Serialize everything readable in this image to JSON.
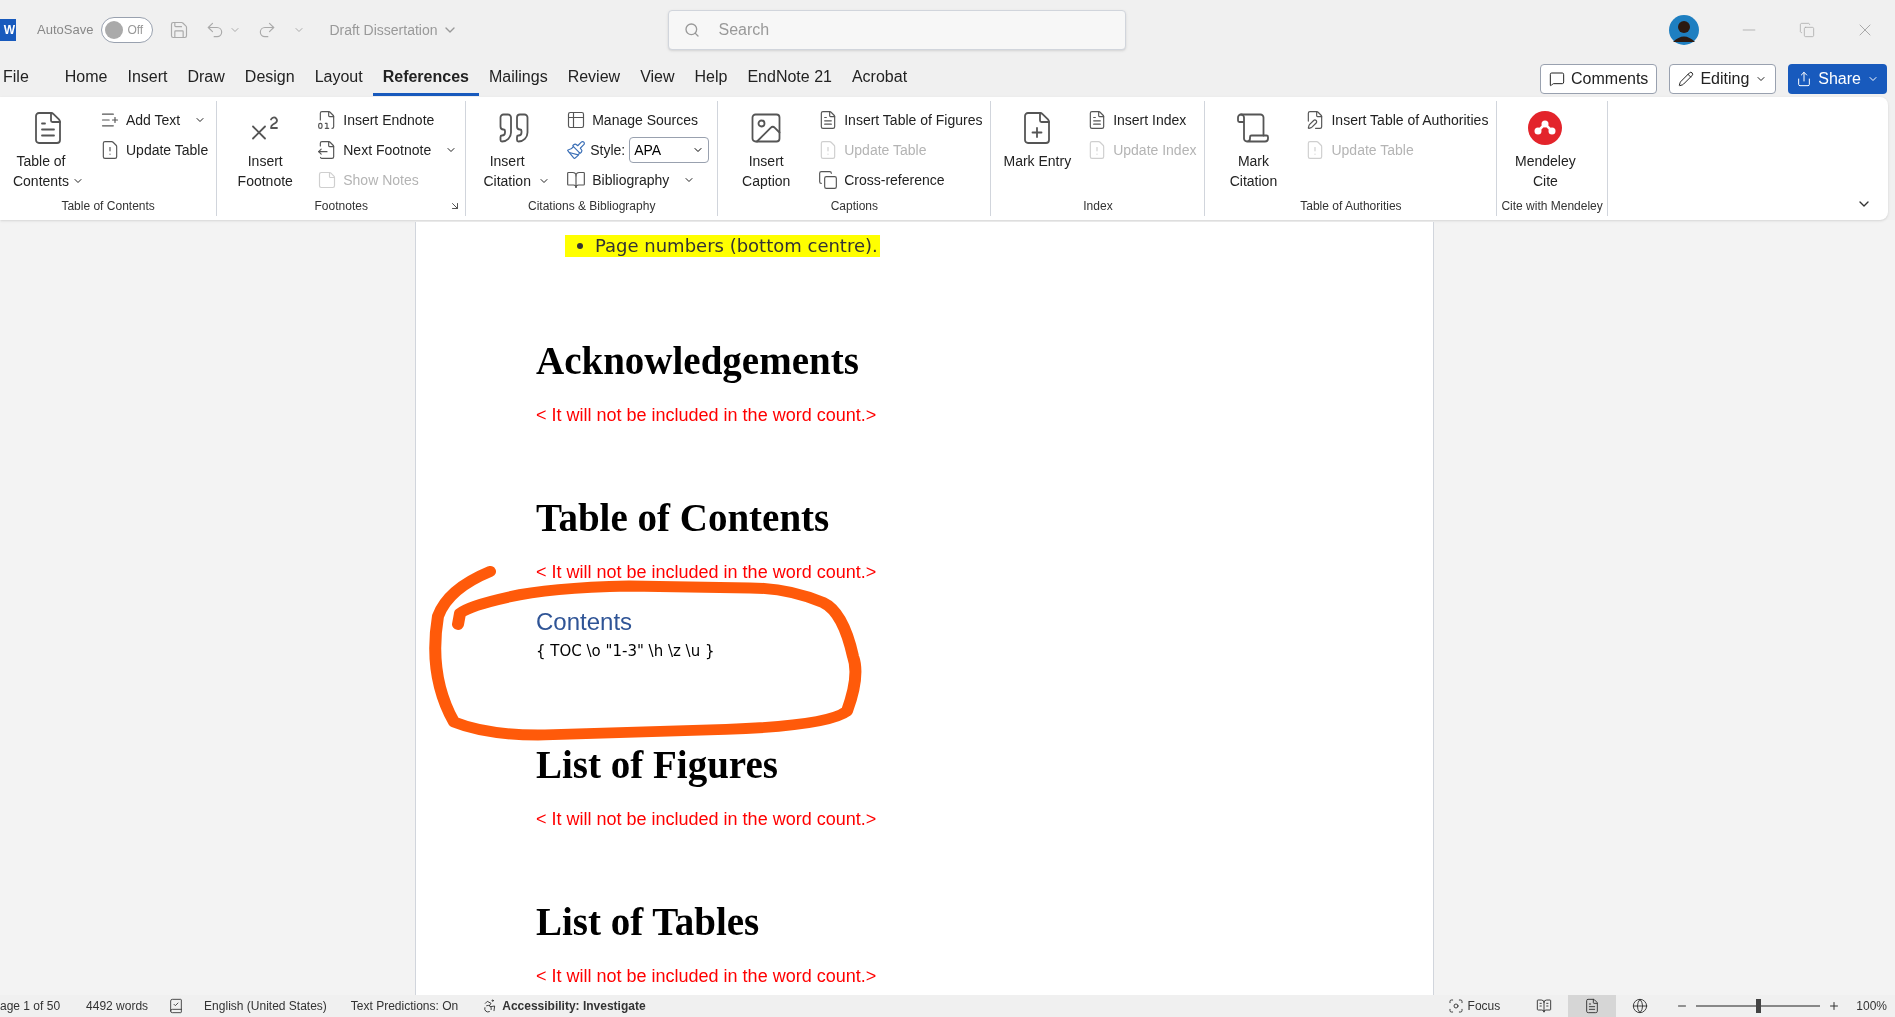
{
  "title_bar": {
    "app_letter": "W",
    "autosave_label": "AutoSave",
    "autosave": {
      "on": false,
      "label": "Off"
    },
    "document_title": "Draft Dissertation",
    "search": {
      "placeholder": "Search"
    }
  },
  "tabs": [
    {
      "label": "File",
      "selected": false
    },
    {
      "label": "Home",
      "selected": false
    },
    {
      "label": "Insert",
      "selected": false
    },
    {
      "label": "Draw",
      "selected": false
    },
    {
      "label": "Design",
      "selected": false
    },
    {
      "label": "Layout",
      "selected": false
    },
    {
      "label": "References",
      "selected": true
    },
    {
      "label": "Mailings",
      "selected": false
    },
    {
      "label": "Review",
      "selected": false
    },
    {
      "label": "View",
      "selected": false
    },
    {
      "label": "Help",
      "selected": false
    },
    {
      "label": "EndNote 21",
      "selected": false
    },
    {
      "label": "Acrobat",
      "selected": false
    }
  ],
  "header_buttons": [
    {
      "kind": "outline",
      "label": "Comments",
      "dropdown": false
    },
    {
      "kind": "outline",
      "label": "Editing",
      "dropdown": true
    },
    {
      "kind": "primary",
      "label": "Share",
      "dropdown": true
    }
  ],
  "ribbon": {
    "groups": [
      {
        "label": "Table of Contents",
        "columns": [
          {
            "kind": "large",
            "label": "Table of Contents",
            "dropdown": true
          },
          {
            "kind": "stack",
            "items": [
              {
                "kind": "button",
                "label": "Add Text",
                "disabled": false,
                "dropdown": true
              },
              {
                "kind": "button",
                "label": "Update Table",
                "disabled": false
              }
            ]
          }
        ]
      },
      {
        "label": "Footnotes",
        "launcher": true,
        "columns": [
          {
            "kind": "large",
            "label": "Insert Footnote",
            "dropdown": false
          },
          {
            "kind": "stack",
            "items": [
              {
                "kind": "button",
                "label": "Insert Endnote",
                "disabled": false
              },
              {
                "kind": "button",
                "label": "Next Footnote",
                "disabled": false,
                "dropdown": true
              },
              {
                "kind": "button",
                "label": "Show Notes",
                "disabled": true
              }
            ]
          }
        ]
      },
      {
        "label": "Citations & Bibliography",
        "columns": [
          {
            "kind": "large",
            "label": "Insert Citation",
            "dropdown": true
          },
          {
            "kind": "stack",
            "items": [
              {
                "kind": "button",
                "label": "Manage Sources",
                "disabled": false
              },
              {
                "kind": "select",
                "label": "Style:",
                "value": "APA"
              },
              {
                "kind": "button",
                "label": "Bibliography",
                "disabled": false,
                "dropdown": true
              }
            ]
          }
        ]
      },
      {
        "label": "Captions",
        "columns": [
          {
            "kind": "large",
            "label": "Insert Caption",
            "dropdown": false
          },
          {
            "kind": "stack",
            "items": [
              {
                "kind": "button",
                "label": "Insert Table of Figures",
                "disabled": false
              },
              {
                "kind": "button",
                "label": "Update Table",
                "disabled": true
              },
              {
                "kind": "button",
                "label": "Cross-reference",
                "disabled": false
              }
            ]
          }
        ]
      },
      {
        "label": "Index",
        "columns": [
          {
            "kind": "large",
            "label": "Mark Entry",
            "dropdown": false
          },
          {
            "kind": "stack",
            "items": [
              {
                "kind": "button",
                "label": "Insert Index",
                "disabled": false
              },
              {
                "kind": "button",
                "label": "Update Index",
                "disabled": true
              }
            ]
          }
        ]
      },
      {
        "label": "Table of Authorities",
        "columns": [
          {
            "kind": "large",
            "label": "Mark Citation",
            "dropdown": false
          },
          {
            "kind": "stack",
            "items": [
              {
                "kind": "button",
                "label": "Insert Table of Authorities",
                "disabled": false
              },
              {
                "kind": "button",
                "label": "Update Table",
                "disabled": true
              }
            ]
          }
        ]
      },
      {
        "label": "Cite with Mendeley",
        "columns": [
          {
            "kind": "large",
            "label": "Mendeley Cite",
            "dropdown": false
          }
        ]
      }
    ]
  },
  "document": {
    "blocks": [
      {
        "kind": "bullet",
        "text": "Page numbers (bottom centre).",
        "highlighted": true
      },
      {
        "kind": "heading",
        "text": "Acknowledgements"
      },
      {
        "kind": "note",
        "text": "< It will not be included in the word count.>"
      },
      {
        "kind": "heading",
        "text": "Table of Contents"
      },
      {
        "kind": "note",
        "text": "< It will not be included in the word count.>"
      },
      {
        "kind": "toc_title",
        "text": "Contents"
      },
      {
        "kind": "field_code",
        "text": "{ TOC \\o \"1-3\" \\h \\z \\u }"
      },
      {
        "kind": "heading",
        "text": "List of Figures"
      },
      {
        "kind": "note",
        "text": "< It will not be included in the word count.>"
      },
      {
        "kind": "heading",
        "text": "List of Tables"
      },
      {
        "kind": "note",
        "text": "< It will not be included in the word count.>"
      }
    ]
  },
  "status_bar": {
    "page": "age 1 of 50",
    "words": "4492 words",
    "language": "English (United States)",
    "text_predictions": "Text Predictions: On",
    "accessibility": "Accessibility: Investigate",
    "focus": "Focus",
    "views": [
      {
        "selected": false
      },
      {
        "selected": true
      },
      {
        "selected": false
      }
    ],
    "zoom": {
      "level": 0.5,
      "reading": "100%"
    }
  }
}
